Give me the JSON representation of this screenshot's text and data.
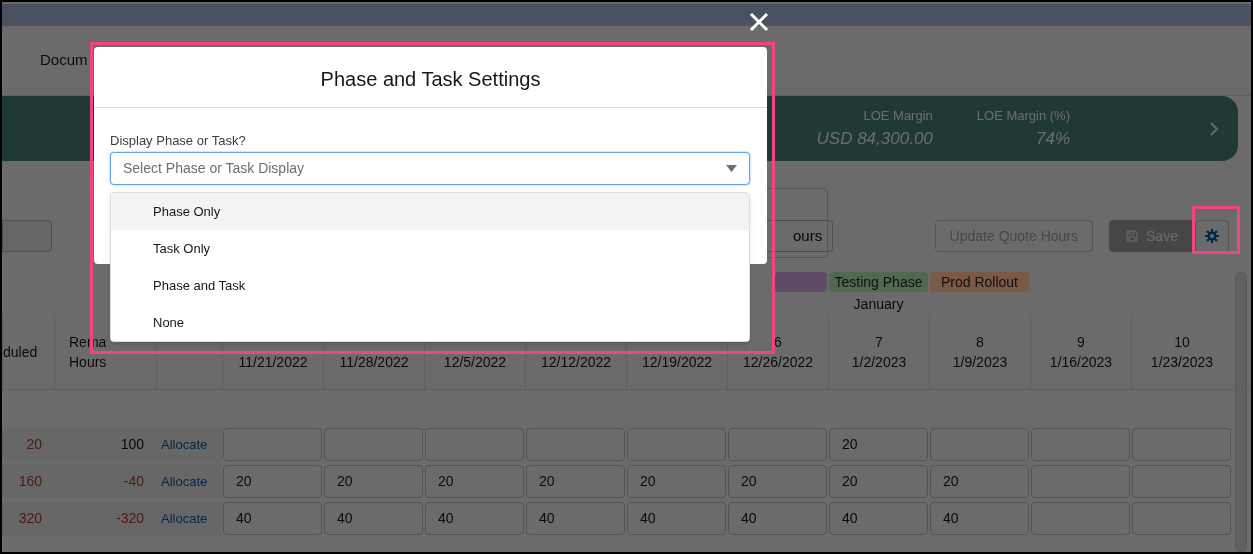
{
  "page": {
    "tab_label": "Docum",
    "banner": {
      "metrics": [
        {
          "label": "LOE Margin",
          "value": "USD 84,300.00"
        },
        {
          "label": "LOE Margin (%)",
          "value": "74%"
        }
      ]
    },
    "toolbar": {
      "partial_button": "ours",
      "buttons": [
        {
          "label": "Update Quote Hours",
          "kind": "outline"
        },
        {
          "label": "Save",
          "kind": "save"
        }
      ]
    },
    "phases": [
      {
        "color": "#5f4a68"
      },
      {
        "label": "Testing Phase",
        "color": "#4f6a4e"
      },
      {
        "label": "Prod Rollout",
        "color": "#7a5a47"
      }
    ],
    "month": {
      "label": "January"
    },
    "table": {
      "columns": [
        {
          "lines": [
            "duled"
          ]
        },
        {
          "lines": [
            "Rema",
            "Hours"
          ]
        },
        {},
        {
          "date": "11/21/2022"
        },
        {
          "date": "11/28/2022"
        },
        {
          "date": "12/5/2022"
        },
        {
          "date": "12/12/2022"
        },
        {
          "date": "12/19/2022"
        },
        {
          "week": "6",
          "date": "12/26/2022"
        },
        {
          "week": "7",
          "date": "1/2/2023"
        },
        {
          "week": "8",
          "date": "1/9/2023"
        },
        {
          "week": "9",
          "date": "1/16/2023"
        },
        {
          "week": "10",
          "date": "1/23/2023"
        }
      ],
      "rows": [
        {
          "scheduled": "20",
          "scheduled_alert": true,
          "remaining": "100",
          "remaining_alert": false,
          "action": "Allocate",
          "weeks": [
            {
              "empty": true
            },
            {
              "empty": true
            },
            {
              "empty": true
            },
            {
              "empty": true
            },
            {
              "empty": true
            },
            {
              "empty": true
            },
            {
              "value": "20"
            },
            {
              "empty": true
            },
            {
              "empty": true
            },
            {
              "empty": true
            }
          ]
        },
        {
          "scheduled": "160",
          "scheduled_alert": true,
          "remaining": "-40",
          "remaining_alert": true,
          "action": "Allocate",
          "weeks": [
            {
              "value": "20"
            },
            {
              "value": "20"
            },
            {
              "value": "20"
            },
            {
              "value": "20"
            },
            {
              "value": "20"
            },
            {
              "value": "20"
            },
            {
              "value": "20"
            },
            {
              "value": "20"
            },
            {
              "empty": true
            },
            {
              "empty": true
            }
          ]
        },
        {
          "scheduled": "320",
          "scheduled_alert": true,
          "remaining": "-320",
          "remaining_alert": true,
          "action": "Allocate",
          "weeks": [
            {
              "value": "40"
            },
            {
              "value": "40"
            },
            {
              "value": "40"
            },
            {
              "value": "40"
            },
            {
              "value": "40"
            },
            {
              "value": "40"
            },
            {
              "value": "40"
            },
            {
              "value": "40"
            },
            {
              "empty": true
            },
            {
              "empty": true
            }
          ]
        }
      ]
    }
  },
  "modal": {
    "title": "Phase and Task Settings",
    "field": {
      "label": "Display Phase or Task?",
      "placeholder": "Select Phase or Task Display",
      "expanded": true
    },
    "options": [
      {
        "label": "Phase Only",
        "highlighted": true
      },
      {
        "label": "Task Only",
        "highlighted": false
      },
      {
        "label": "Phase and Task",
        "highlighted": false
      },
      {
        "label": "None",
        "highlighted": false
      }
    ]
  }
}
